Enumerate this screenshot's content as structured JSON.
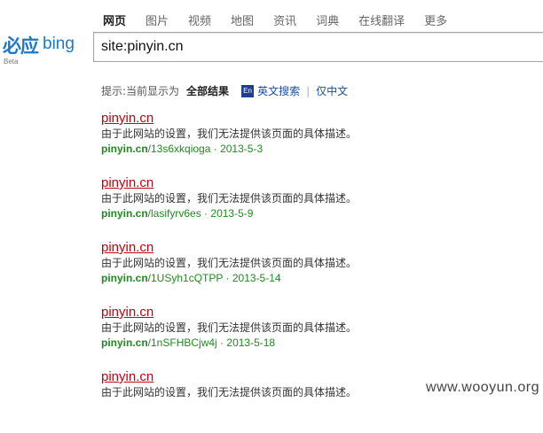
{
  "nav": {
    "items": [
      "网页",
      "图片",
      "视频",
      "地图",
      "资讯",
      "词典",
      "在线翻译",
      "更多"
    ],
    "active_index": 0
  },
  "logo": {
    "cn_text": "必应",
    "en_text": "bing",
    "beta": "Beta",
    "color": "#1a79c9"
  },
  "search": {
    "value": "site:pinyin.cn"
  },
  "hint": {
    "prefix": "提示:当前显示为",
    "current": "全部结果",
    "en_icon": "En",
    "english_search": "英文搜索",
    "separator": "|",
    "chinese_only": "仅中文"
  },
  "results": [
    {
      "title": "pinyin.cn",
      "desc": "由于此网站的设置，我们无法提供该页面的具体描述。",
      "domain": "pinyin.cn",
      "path": "/13s6xkqioga",
      "date": "2013-5-3"
    },
    {
      "title": "pinyin.cn",
      "desc": "由于此网站的设置，我们无法提供该页面的具体描述。",
      "domain": "pinyin.cn",
      "path": "/lasifyrv6es",
      "date": "2013-5-9"
    },
    {
      "title": "pinyin.cn",
      "desc": "由于此网站的设置，我们无法提供该页面的具体描述。",
      "domain": "pinyin.cn",
      "path": "/1USyh1cQTPP",
      "date": "2013-5-14"
    },
    {
      "title": "pinyin.cn",
      "desc": "由于此网站的设置，我们无法提供该页面的具体描述。",
      "domain": "pinyin.cn",
      "path": "/1nSFHBCjw4j",
      "date": "2013-5-18"
    },
    {
      "title": "pinyin.cn",
      "desc": "由于此网站的设置，我们无法提供该页面的具体描述。",
      "domain": "",
      "path": "",
      "date": ""
    }
  ],
  "date_separator": "·",
  "watermark": "www.wooyun.org",
  "colors": {
    "title_link": "#c3020e",
    "url_green": "#1f8a1f",
    "en_icon_bg": "#1e3f8f"
  }
}
